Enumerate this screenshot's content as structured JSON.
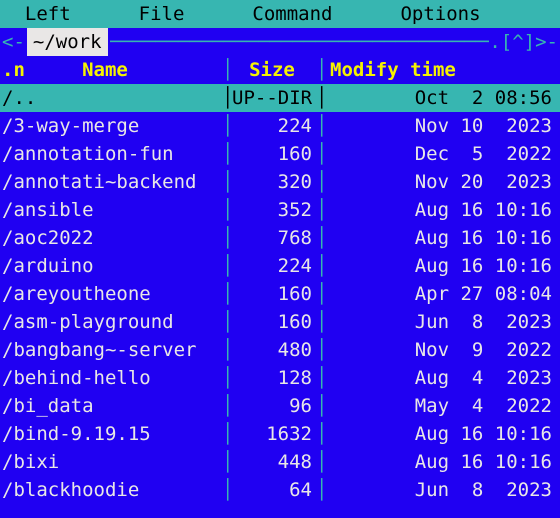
{
  "menubar": {
    "items": [
      {
        "label": "  Left"
      },
      {
        "label": "File"
      },
      {
        "label": "Command"
      },
      {
        "label": "Options"
      }
    ]
  },
  "panel": {
    "left_arrow": "<-",
    "path": "~/work",
    "right_cap": ".[^]>-",
    "header": {
      "sort_indicator": ".n",
      "name": "Name",
      "size": "Size",
      "mtime": "Modify time"
    },
    "rows": [
      {
        "selected": true,
        "name": "/..",
        "size": "UP--DIR",
        "mtime": "Oct  2 08:56"
      },
      {
        "selected": false,
        "name": "/3-way-merge",
        "size": "224",
        "mtime": "Nov 10  2023"
      },
      {
        "selected": false,
        "name": "/annotation-fun",
        "size": "160",
        "mtime": "Dec  5  2022"
      },
      {
        "selected": false,
        "name": "/annotati~backend",
        "size": "320",
        "mtime": "Nov 20  2023"
      },
      {
        "selected": false,
        "name": "/ansible",
        "size": "352",
        "mtime": "Aug 16 10:16"
      },
      {
        "selected": false,
        "name": "/aoc2022",
        "size": "768",
        "mtime": "Aug 16 10:16"
      },
      {
        "selected": false,
        "name": "/arduino",
        "size": "224",
        "mtime": "Aug 16 10:16"
      },
      {
        "selected": false,
        "name": "/areyoutheone",
        "size": "160",
        "mtime": "Apr 27 08:04"
      },
      {
        "selected": false,
        "name": "/asm-playground",
        "size": "160",
        "mtime": "Jun  8  2023"
      },
      {
        "selected": false,
        "name": "/bangbang~-server",
        "size": "480",
        "mtime": "Nov  9  2022"
      },
      {
        "selected": false,
        "name": "/behind-hello",
        "size": "128",
        "mtime": "Aug  4  2023"
      },
      {
        "selected": false,
        "name": "/bi_data",
        "size": "96",
        "mtime": "May  4  2022"
      },
      {
        "selected": false,
        "name": "/bind-9.19.15",
        "size": "1632",
        "mtime": "Aug 16 10:16"
      },
      {
        "selected": false,
        "name": "/bixi",
        "size": "448",
        "mtime": "Aug 16 10:16"
      },
      {
        "selected": false,
        "name": "/blackhoodie",
        "size": "64",
        "mtime": "Jun  8  2023"
      }
    ]
  }
}
